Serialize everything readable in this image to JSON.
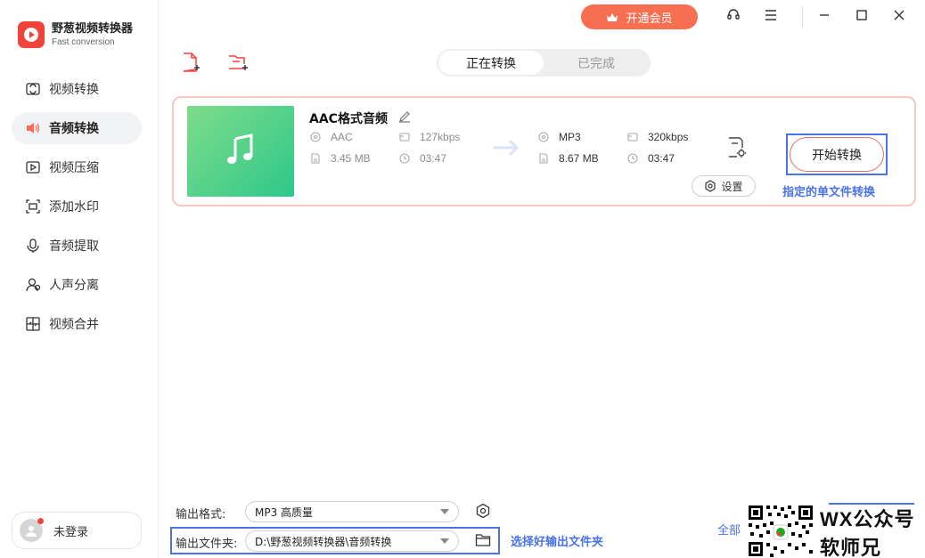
{
  "app": {
    "name": "野葱视频转换器",
    "subtitle": "Fast conversion"
  },
  "sidebar": {
    "items": [
      {
        "label": "视频转换",
        "icon": "video-convert-icon"
      },
      {
        "label": "音频转换",
        "icon": "audio-convert-icon",
        "active": true
      },
      {
        "label": "视频压缩",
        "icon": "video-compress-icon"
      },
      {
        "label": "添加水印",
        "icon": "watermark-icon"
      },
      {
        "label": "音频提取",
        "icon": "audio-extract-icon"
      },
      {
        "label": "人声分离",
        "icon": "vocal-separate-icon"
      },
      {
        "label": "视频合并",
        "icon": "video-merge-icon"
      }
    ],
    "user": {
      "label": "未登录"
    }
  },
  "topbar": {
    "vip_label": "开通会员"
  },
  "tabs": [
    {
      "label": "正在转换",
      "active": true
    },
    {
      "label": "已完成",
      "active": false
    }
  ],
  "file": {
    "name": "AAC格式音频",
    "source": {
      "format": "AAC",
      "bitrate": "127kbps",
      "size": "3.45 MB",
      "duration": "03:47"
    },
    "target": {
      "format": "MP3",
      "bitrate": "320kbps",
      "size": "8.67 MB",
      "duration": "03:47"
    },
    "settings_label": "设置",
    "start_label": "开始转换",
    "annotation": "指定的单文件转换"
  },
  "output": {
    "format_label": "输出格式:",
    "format_value": "MP3 高质量",
    "folder_label": "输出文件夹:",
    "folder_value": "D:\\野葱视频转换器\\音频转换",
    "folder_annotation": "选择好输出文件夹",
    "all_label": "全部"
  },
  "watermark": {
    "line1": "WX公众号",
    "line2": "软师兄"
  },
  "colors": {
    "brand": "#f0443a",
    "vip": "#f76f53",
    "accent_blue": "#4a72e8",
    "thumb_start": "#7edc8a",
    "thumb_end": "#2ec88a"
  }
}
